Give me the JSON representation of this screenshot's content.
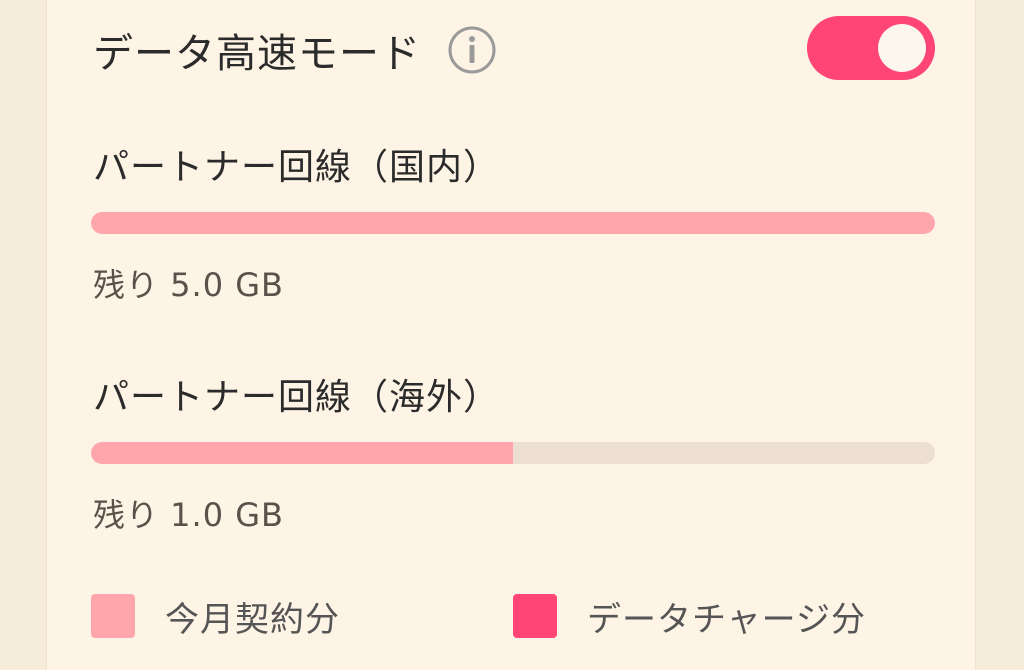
{
  "header": {
    "title": "データ高速モード",
    "info_icon": "info-icon",
    "toggle_on": true
  },
  "sections": [
    {
      "title": "パートナー回線（国内）",
      "used_fraction": 1.0,
      "remaining": "残り 5.0 GB"
    },
    {
      "title": "パートナー回線（海外）",
      "used_fraction": 0.5,
      "remaining": "残り 1.0 GB"
    }
  ],
  "legend": [
    {
      "label": "今月契約分",
      "color": "#ffa6ad"
    },
    {
      "label": "データチャージ分",
      "color": "#ff4576"
    }
  ],
  "colors": {
    "accent": "#ff4576",
    "bar_fill": "#ffa6ad",
    "bar_track": "#ecdfd2",
    "card_bg": "#fdf4e6"
  }
}
